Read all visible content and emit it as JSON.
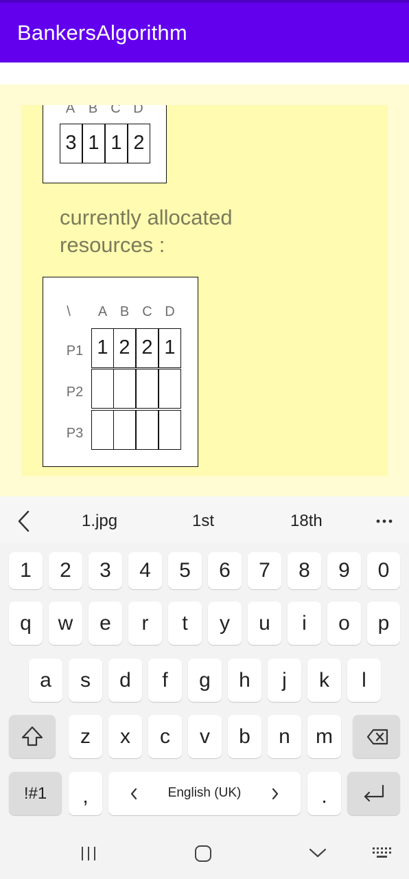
{
  "app": {
    "title": "BankersAlgorithm"
  },
  "top_matrix": {
    "headers": [
      "A",
      "B",
      "C",
      "D"
    ],
    "values": [
      "3",
      "1",
      "1",
      "2"
    ]
  },
  "section_label": "currently allocated resources :",
  "alloc_matrix": {
    "corner": "\\",
    "headers": [
      "A",
      "B",
      "C",
      "D"
    ],
    "rows": [
      {
        "label": "P1",
        "values": [
          "1",
          "2",
          "2",
          "1"
        ]
      },
      {
        "label": "P2",
        "values": [
          "",
          "",
          "",
          ""
        ]
      },
      {
        "label": "P3",
        "values": [
          "",
          "",
          "",
          ""
        ]
      }
    ]
  },
  "keyboard": {
    "suggestions": [
      "1.jpg",
      "1st",
      "18th"
    ],
    "number_row": [
      "1",
      "2",
      "3",
      "4",
      "5",
      "6",
      "7",
      "8",
      "9",
      "0"
    ],
    "row1": [
      "q",
      "w",
      "e",
      "r",
      "t",
      "y",
      "u",
      "i",
      "o",
      "p"
    ],
    "row2": [
      "a",
      "s",
      "d",
      "f",
      "g",
      "h",
      "j",
      "k",
      "l"
    ],
    "row3": [
      "z",
      "x",
      "c",
      "v",
      "b",
      "n",
      "m"
    ],
    "symbols_label": "!#1",
    "comma": ",",
    "period": ".",
    "space_label": "English (UK)"
  },
  "icons": {
    "back": "chevron-left-icon",
    "more": "more-dots-icon",
    "shift": "shift-icon",
    "backspace": "backspace-icon",
    "enter": "enter-icon",
    "nav_recents": "recents-icon",
    "nav_home": "home-icon",
    "nav_back": "chevron-down-icon",
    "nav_keyboard": "keyboard-icon"
  }
}
